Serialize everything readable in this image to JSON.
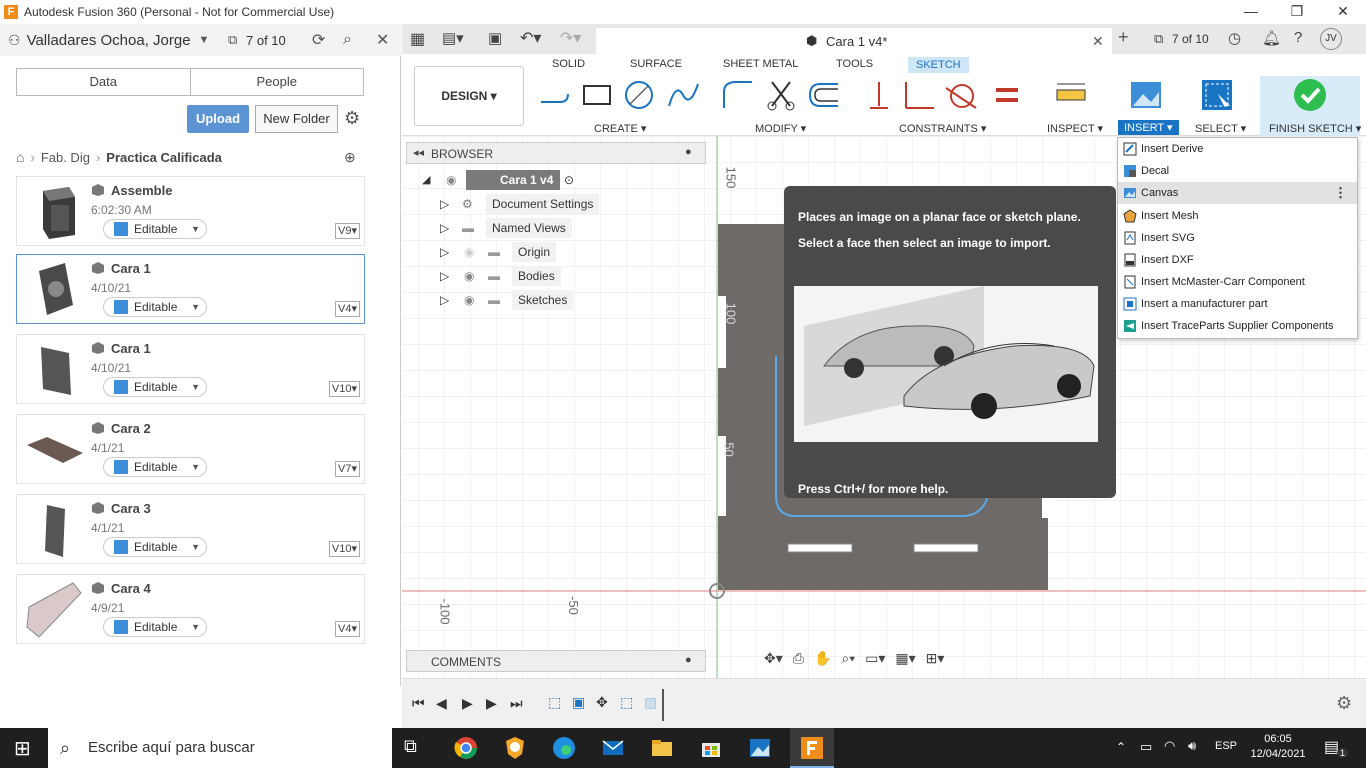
{
  "window": {
    "title": "Autodesk Fusion 360 (Personal - Not for Commercial Use)",
    "app_letter": "F"
  },
  "left": {
    "user": "Valladares Ochoa, Jorge",
    "count": "7 of 10",
    "tabs": [
      "Data",
      "People"
    ],
    "upload": "Upload",
    "new_folder": "New Folder",
    "breadcrumb": [
      "Fab. Dig",
      "Practica Calificada"
    ],
    "files": [
      {
        "name": "Assemble",
        "date": "6:02:30 AM",
        "status": "Editable",
        "version": "V9"
      },
      {
        "name": "Cara 1",
        "date": "4/10/21",
        "status": "Editable",
        "version": "V4"
      },
      {
        "name": "Cara 1",
        "date": "4/10/21",
        "status": "Editable",
        "version": "V10"
      },
      {
        "name": "Cara 2",
        "date": "4/1/21",
        "status": "Editable",
        "version": "V7"
      },
      {
        "name": "Cara 3",
        "date": "4/1/21",
        "status": "Editable",
        "version": "V10"
      },
      {
        "name": "Cara 4",
        "date": "4/9/21",
        "status": "Editable",
        "version": "V4"
      }
    ]
  },
  "tabbar": {
    "doc_title": "Cara 1 v4*",
    "count": "7 of 10",
    "avatar": "JV"
  },
  "ribbon": {
    "workspace": "DESIGN",
    "tabs": [
      "SOLID",
      "SURFACE",
      "SHEET METAL",
      "TOOLS",
      "SKETCH"
    ],
    "groups": [
      "CREATE",
      "MODIFY",
      "CONSTRAINTS",
      "INSPECT",
      "INSERT",
      "SELECT",
      "FINISH SKETCH"
    ]
  },
  "browser": {
    "title": "BROWSER",
    "root": "Cara 1 v4",
    "items": [
      "Document Settings",
      "Named Views",
      "Origin",
      "Bodies",
      "Sketches"
    ],
    "comments": "COMMENTS"
  },
  "axes": {
    "labels": [
      "150",
      "100",
      "50",
      "-100",
      "-50"
    ]
  },
  "tooltip": {
    "line1": "Places an image on a planar face or sketch plane.",
    "line2": "Select a face then select an image to import.",
    "footer": "Press Ctrl+/ for more help."
  },
  "insert_menu": [
    "Insert Derive",
    "Decal",
    "Canvas",
    "Insert Mesh",
    "Insert SVG",
    "Insert DXF",
    "Insert McMaster-Carr Component",
    "Insert a manufacturer part",
    "Insert TraceParts Supplier Components"
  ],
  "taskbar": {
    "search_placeholder": "Escribe aquí para buscar",
    "lang": "ESP",
    "time": "06:05",
    "date": "12/04/2021",
    "notif": "1"
  },
  "colors": {
    "accent": "#1a74c4",
    "upload": "#5b93d3",
    "tooltip_bg": "#4a4a4a",
    "sketch_plane": "#6e6a67"
  }
}
